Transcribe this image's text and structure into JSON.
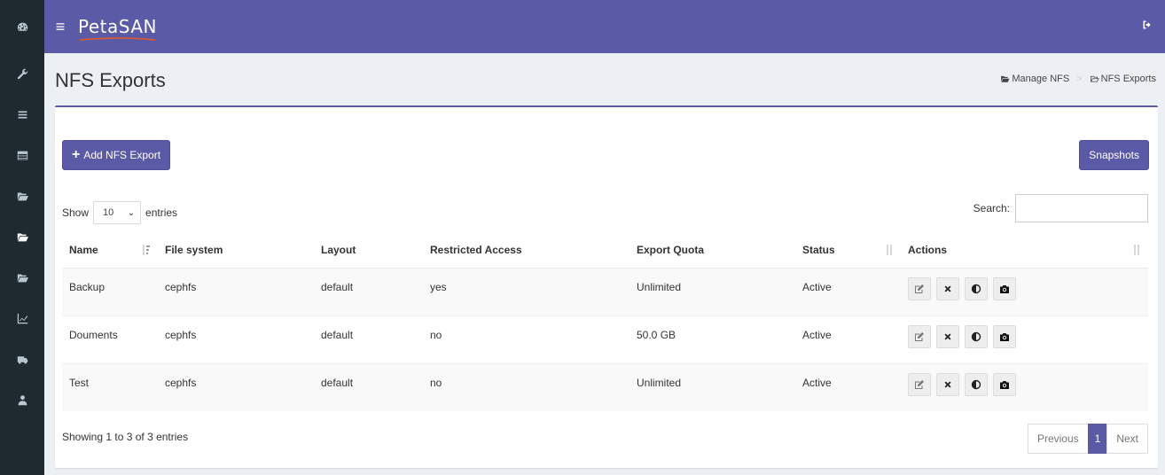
{
  "app": {
    "logo_text": "PetaSAN",
    "menu_icon": "hamburger-icon",
    "logout_icon": "sign-out-icon"
  },
  "sidebar": {
    "items": [
      {
        "icon": "dashboard-icon"
      },
      {
        "icon": "wrench-icon"
      },
      {
        "icon": "list-icon"
      },
      {
        "icon": "table-icon"
      },
      {
        "icon": "folder-open-icon"
      },
      {
        "icon": "folder-open-icon",
        "active": true
      },
      {
        "icon": "folder-open-icon"
      },
      {
        "icon": "line-chart-icon"
      },
      {
        "icon": "ambulance-icon"
      },
      {
        "icon": "user-icon"
      }
    ]
  },
  "header": {
    "title": "NFS Exports",
    "breadcrumb": [
      {
        "label": "Manage NFS",
        "icon": "folder-open-icon"
      },
      {
        "label": "NFS Exports",
        "icon": "folder-open-outline-icon"
      }
    ]
  },
  "toolbar": {
    "add_label": "Add NFS Export",
    "snapshots_label": "Snapshots"
  },
  "length_menu": {
    "show_label": "Show",
    "value": "10",
    "entries_label": "entries"
  },
  "search": {
    "label": "Search:",
    "value": ""
  },
  "table": {
    "columns": [
      "Name",
      "File system",
      "Layout",
      "Restricted Access",
      "Export Quota",
      "Status",
      "Actions"
    ],
    "rows": [
      {
        "name": "Backup",
        "fs": "cephfs",
        "layout": "default",
        "restricted": "yes",
        "quota": "Unlimited",
        "status": "Active"
      },
      {
        "name": "Douments",
        "fs": "cephfs",
        "layout": "default",
        "restricted": "no",
        "quota": "50.0 GB",
        "status": "Active"
      },
      {
        "name": "Test",
        "fs": "cephfs",
        "layout": "default",
        "restricted": "no",
        "quota": "Unlimited",
        "status": "Active"
      }
    ]
  },
  "footer": {
    "info": "Showing 1 to 3 of 3 entries",
    "pagination": {
      "previous": "Previous",
      "current": "1",
      "next": "Next"
    }
  },
  "colors": {
    "brand": "#5b5aa6",
    "sidebar_bg": "#1f2a30",
    "page_bg": "#ecf0f5"
  }
}
